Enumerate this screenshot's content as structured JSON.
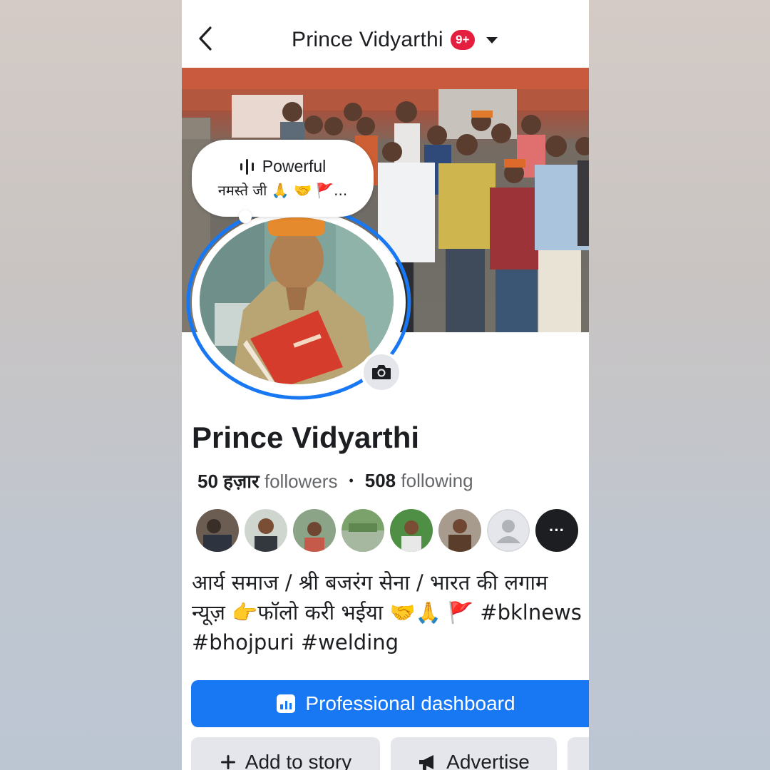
{
  "header": {
    "title": "Prince Vidyarthi",
    "badge": "9+"
  },
  "note": {
    "title": "Powerful",
    "text": "नमस्ते जी 🙏 🤝 🚩..."
  },
  "profile": {
    "name": "Prince Vidyarthi",
    "followers_count": "50 हज़ार",
    "followers_label": "followers",
    "following_count": "508",
    "following_label": "following",
    "more_friends_label": "···"
  },
  "bio": {
    "line1": "आर्य समाज / श्री बजरंग सेना / भारत की लगाम",
    "line2": "न्यूज़ 👉फॉलो करी भईया 🤝🙏 🚩 #bklnews",
    "line3": "#bhojpuri #welding"
  },
  "buttons": {
    "professional_dashboard": "Professional dashboard",
    "add_to_story": "Add to story",
    "advertise": "Advertise"
  },
  "colors": {
    "accent": "#1877f2",
    "badge": "#e41e3f",
    "secondary_button": "#e4e6eb"
  }
}
